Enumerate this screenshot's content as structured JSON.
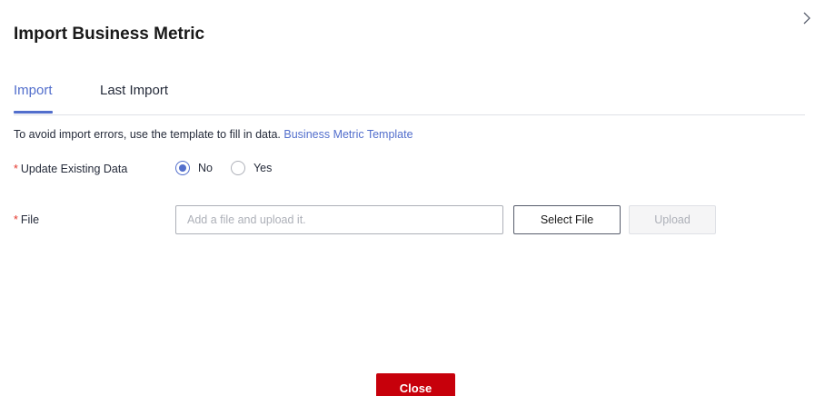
{
  "dialog": {
    "title": "Import Business Metric",
    "close_icon": "close-chevron-icon"
  },
  "tabs": [
    {
      "label": "Import",
      "active": true
    },
    {
      "label": "Last Import",
      "active": false
    }
  ],
  "hint": {
    "text": "To avoid import errors, use the template to fill in data.",
    "link": "Business Metric Template"
  },
  "update_existing": {
    "required_mark": "*",
    "label": "Update Existing Data",
    "options": [
      {
        "label": "No",
        "checked": true
      },
      {
        "label": "Yes",
        "checked": false
      }
    ]
  },
  "file": {
    "required_mark": "*",
    "label": "File",
    "value": "",
    "placeholder": "Add a file and upload it.",
    "select_label": "Select File",
    "upload_label": "Upload",
    "upload_enabled": false
  },
  "footer": {
    "close_label": "Close"
  },
  "colors": {
    "accent": "#526ecc",
    "danger": "#c7000b",
    "required": "#e4372d"
  }
}
